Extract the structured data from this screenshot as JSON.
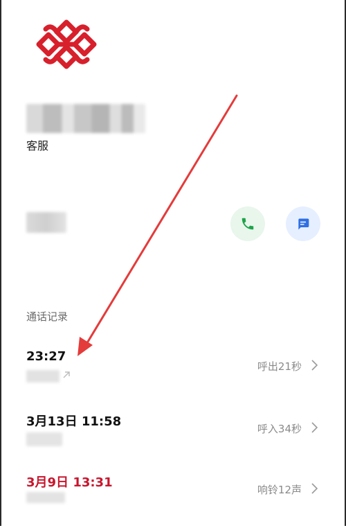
{
  "contact": {
    "label": "客服"
  },
  "call_log": {
    "title": "通话记录",
    "records": [
      {
        "time": "23:27",
        "status": "呼出21秒",
        "missed": false
      },
      {
        "time": "3月13日 11:58",
        "status": "呼入34秒",
        "missed": false
      },
      {
        "time": "3月9日 13:31",
        "status": "响铃12声",
        "missed": true
      }
    ]
  },
  "colors": {
    "logo_red": "#d7202c",
    "missed_red": "#c8162d",
    "call_green": "#1fa34a",
    "message_blue": "#2f6fe4",
    "annotation_arrow": "#e43b3b"
  },
  "icons": {
    "logo": "china-unicom-knot-logo",
    "call": "phone-icon",
    "message": "message-icon",
    "outgoing": "outgoing-call-icon",
    "chevron": "chevron-right-icon"
  }
}
